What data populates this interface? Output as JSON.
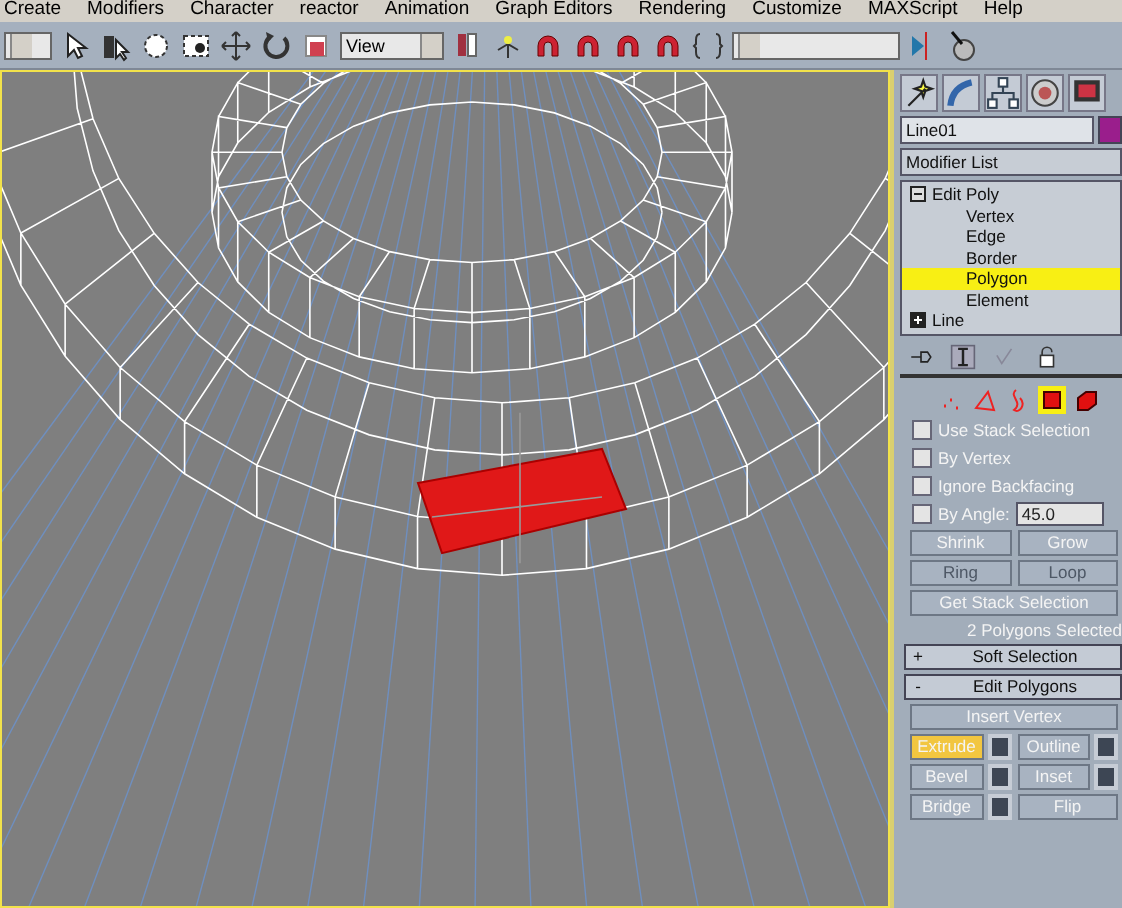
{
  "menu_bar": [
    "Create",
    "Modifiers",
    "Character",
    "reactor",
    "Animation",
    "Graph Editors",
    "Rendering",
    "Customize",
    "MAXScript",
    "Help"
  ],
  "toolbar": {
    "reference_dropdown": "View"
  },
  "command_panel": {
    "object_name": "Line01",
    "modifier_list": "Modifier List",
    "stack": [
      {
        "label": "Edit Poly",
        "expanded": true,
        "selected": false,
        "children": [
          {
            "label": "Vertex",
            "selected": false
          },
          {
            "label": "Edge",
            "selected": false
          },
          {
            "label": "Border",
            "selected": false
          },
          {
            "label": "Polygon",
            "selected": true
          },
          {
            "label": "Element",
            "selected": false
          }
        ]
      },
      {
        "label": "Line",
        "expanded": false,
        "selected": false
      }
    ],
    "selection_levels": [
      {
        "kind": "vertex",
        "selected": false
      },
      {
        "kind": "edge",
        "selected": false
      },
      {
        "kind": "border",
        "selected": false
      },
      {
        "kind": "polygon",
        "selected": true
      },
      {
        "kind": "element",
        "selected": false
      }
    ],
    "options": [
      {
        "label": "Use Stack Selection",
        "checked": false
      },
      {
        "label": "By Vertex",
        "checked": false
      },
      {
        "label": "Ignore Backfacing",
        "checked": false
      },
      {
        "label": "By Angle:",
        "checked": false,
        "value": "45.0"
      }
    ],
    "selection_buttons": [
      {
        "label": "Shrink",
        "disabled": false
      },
      {
        "label": "Grow",
        "disabled": false
      },
      {
        "label": "Ring",
        "disabled": true
      },
      {
        "label": "Loop",
        "disabled": true
      },
      {
        "label": "Get Stack Selection",
        "disabled": false
      }
    ],
    "status": "2 Polygons Selected",
    "rollouts": [
      {
        "sign": "+",
        "label": "Soft Selection"
      },
      {
        "sign": "-",
        "label": "Edit Polygons"
      }
    ],
    "edit_buttons": [
      {
        "label": "Insert Vertex",
        "active": false,
        "settings": false
      },
      {
        "label": "Extrude",
        "active": true,
        "settings": true
      },
      {
        "label": "Outline",
        "active": false,
        "settings": true
      },
      {
        "label": "Bevel",
        "active": false,
        "settings": true
      },
      {
        "label": "Inset",
        "active": false,
        "settings": true
      },
      {
        "label": "Bridge",
        "active": false,
        "settings": true
      },
      {
        "label": "Flip",
        "active": false,
        "settings": false
      }
    ]
  }
}
